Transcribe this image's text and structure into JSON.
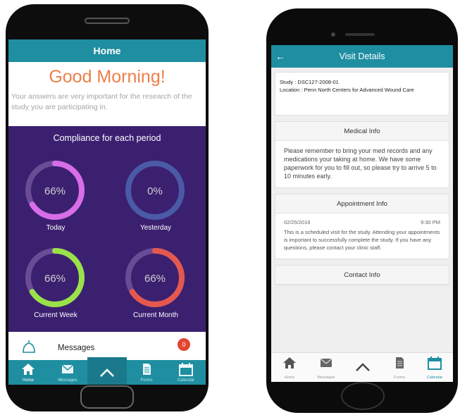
{
  "home_screen": {
    "title": "Home",
    "greeting": "Good Morning!",
    "subtext": "Your answers are very important for the research of the study you are participating in.",
    "compliance_title": "Compliance for each period",
    "rings": [
      {
        "value_text": "66%",
        "value": 66,
        "label": "Today",
        "color": "#d86de8"
      },
      {
        "value_text": "0%",
        "value": 0,
        "label": "Yesterday",
        "color": "#4a5aa6"
      },
      {
        "value_text": "66%",
        "value": 66,
        "label": "Current Week",
        "color": "#9be14a"
      },
      {
        "value_text": "66%",
        "value": 66,
        "label": "Current Month",
        "color": "#e5584e"
      }
    ],
    "messages_label": "Messages",
    "messages_badge": "0",
    "bottom_nav": [
      {
        "label": "Home",
        "icon": "home-icon"
      },
      {
        "label": "Messages",
        "icon": "envelope-icon"
      },
      {
        "label": "",
        "icon": "chevron-up-icon"
      },
      {
        "label": "Forms",
        "icon": "document-icon"
      },
      {
        "label": "Calendar",
        "icon": "calendar-icon"
      }
    ]
  },
  "visit_screen": {
    "title": "Visit Details",
    "study_line": "Study : DSC127-2008-01",
    "location_line": "Location : Penn North Centers for Advanced Wound Care",
    "medical_title": "Medical Info",
    "medical_body": "Please remember to bring your med records and any medications your taking at home. We have some paperwork for you to fill out, so please try to arrive 5 to 10 minutes early.",
    "appointment_title": "Appointment Info",
    "appointment_date": "02/25/2016",
    "appointment_time": "9:30 PM",
    "appointment_body": "This is a scheduled visit for the study. Attending your appointments is important to successfully complete the study. If you have any questions, please contact your clinic staff.",
    "contact_title": "Contact Info",
    "bottom_nav": [
      {
        "label": "Home",
        "icon": "home-icon"
      },
      {
        "label": "Messages",
        "icon": "envelope-icon"
      },
      {
        "label": "",
        "icon": "chevron-up-icon"
      },
      {
        "label": "Forms",
        "icon": "document-icon"
      },
      {
        "label": "Calendar",
        "icon": "calendar-icon"
      }
    ]
  },
  "colors": {
    "accent": "#1f8ea1",
    "greeting": "#ef7e4a",
    "panel": "#3b2070",
    "badge": "#e34432"
  }
}
